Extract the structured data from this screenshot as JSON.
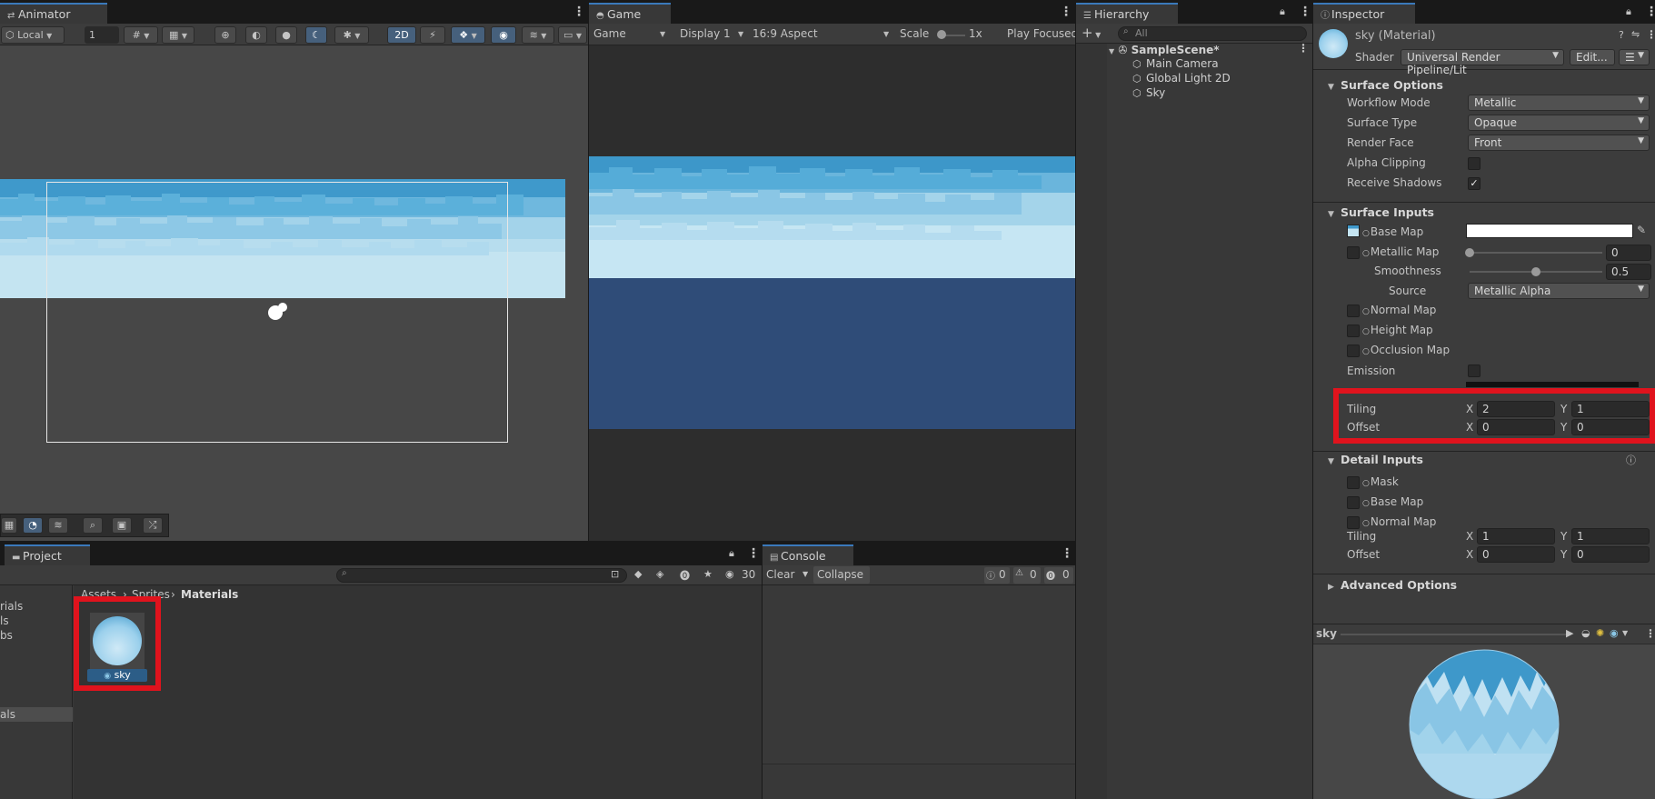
{
  "animator": {
    "tab": "Animator",
    "pivot": "Local",
    "grid_value": "1",
    "mode_2d": "2D"
  },
  "game": {
    "tab": "Game",
    "view": "Game",
    "display": "Display 1",
    "aspect": "16:9 Aspect",
    "scale_label": "Scale",
    "scale_value": "1x",
    "play_mode": "Play Focused"
  },
  "hierarchy": {
    "tab": "Hierarchy",
    "search_placeholder": "All",
    "scene": "SampleScene*",
    "items": [
      "Main Camera",
      "Global Light 2D",
      "Sky"
    ]
  },
  "inspector": {
    "tab": "Inspector",
    "title": "sky (Material)",
    "shader_label": "Shader",
    "shader_value": "Universal Render Pipeline/Lit",
    "edit_button": "Edit...",
    "surface_options": {
      "header": "Surface Options",
      "workflow_label": "Workflow Mode",
      "workflow_value": "Metallic",
      "surface_type_label": "Surface Type",
      "surface_type_value": "Opaque",
      "render_face_label": "Render Face",
      "render_face_value": "Front",
      "alpha_clipping_label": "Alpha Clipping",
      "receive_shadows_label": "Receive Shadows",
      "receive_shadows_check": "✓"
    },
    "surface_inputs": {
      "header": "Surface Inputs",
      "base_map": "Base Map",
      "metallic_map": "Metallic Map",
      "metallic_value": "0",
      "smoothness": "Smoothness",
      "smoothness_value": "0.5",
      "source": "Source",
      "source_value": "Metallic Alpha",
      "normal_map": "Normal Map",
      "height_map": "Height Map",
      "occlusion_map": "Occlusion Map",
      "emission": "Emission",
      "tiling_label": "Tiling",
      "offset_label": "Offset",
      "x": "X",
      "y": "Y",
      "tiling_x": "2",
      "tiling_y": "1",
      "offset_x": "0",
      "offset_y": "0"
    },
    "detail_inputs": {
      "header": "Detail Inputs",
      "mask": "Mask",
      "base_map": "Base Map",
      "normal_map": "Normal Map",
      "tiling_label": "Tiling",
      "offset_label": "Offset",
      "x": "X",
      "y": "Y",
      "tiling_x": "1",
      "tiling_y": "1",
      "offset_x": "0",
      "offset_y": "0"
    },
    "advanced_header": "Advanced Options",
    "preview_title": "sky"
  },
  "project": {
    "tab": "Project",
    "hidden_count": "30",
    "breadcrumb_root": "Assets",
    "breadcrumb_mid": "Sprites",
    "breadcrumb_current": "Materials",
    "sidebar_items": [
      "rials",
      "ls",
      "bs",
      "als"
    ],
    "asset_name": "sky"
  },
  "console": {
    "tab": "Console",
    "clear": "Clear",
    "collapse": "Collapse",
    "log_count": "0",
    "warn_count": "0",
    "error_count": "0"
  },
  "colors": {
    "accent": "#3a79bb",
    "highlight_box": "#e0131d",
    "game_bg": "#2f4c78",
    "sky_light": "#c4e4f1",
    "sky_dark": "#3d97c9"
  }
}
